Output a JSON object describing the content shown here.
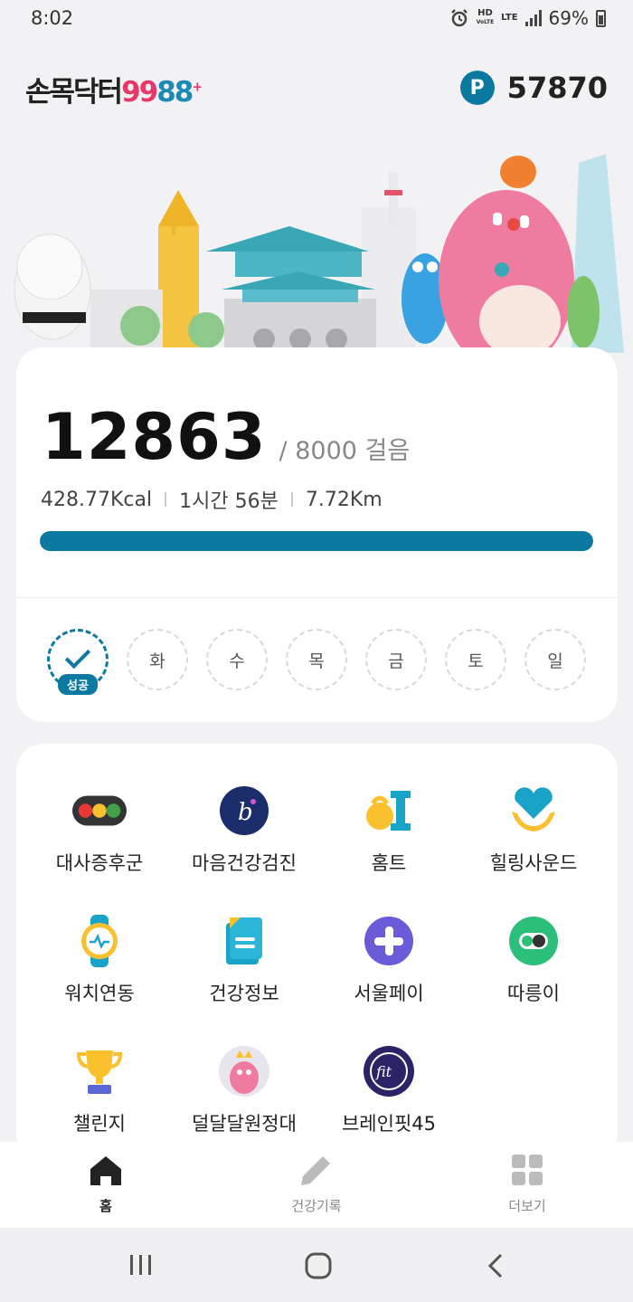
{
  "status": {
    "time": "8:02",
    "network_top": "HD",
    "network_sub": "VoLTE",
    "lte": "LTE",
    "battery": "69%"
  },
  "header": {
    "logo_text": "손목닥터",
    "logo_num_a": "99",
    "logo_num_b": "88",
    "logo_plus": "+",
    "point_badge": "P",
    "points": "57870"
  },
  "steps": {
    "count": "12863",
    "goal": "/ 8000 걸음",
    "kcal": "428.77Kcal",
    "time": "1시간 56분",
    "distance": "7.72Km",
    "progress": 1.0
  },
  "week": [
    {
      "label": "",
      "done": true,
      "badge": "성공"
    },
    {
      "label": "화",
      "done": false
    },
    {
      "label": "수",
      "done": false
    },
    {
      "label": "목",
      "done": false
    },
    {
      "label": "금",
      "done": false
    },
    {
      "label": "토",
      "done": false
    },
    {
      "label": "일",
      "done": false
    }
  ],
  "menu": [
    {
      "label": "대사증후군",
      "icon": "traffic-light-icon"
    },
    {
      "label": "마음건강검진",
      "icon": "mind-check-icon"
    },
    {
      "label": "홈트",
      "icon": "kettlebell-icon"
    },
    {
      "label": "힐링사운드",
      "icon": "heart-hands-icon"
    },
    {
      "label": "워치연동",
      "icon": "smartwatch-icon"
    },
    {
      "label": "건강정보",
      "icon": "document-icon"
    },
    {
      "label": "서울페이",
      "icon": "plus-circle-icon"
    },
    {
      "label": "따릉이",
      "icon": "bike-toggle-icon"
    },
    {
      "label": "챌린지",
      "icon": "trophy-icon"
    },
    {
      "label": "덜달달원정대",
      "icon": "character-icon"
    },
    {
      "label": "브레인핏45",
      "icon": "brainfit-icon"
    }
  ],
  "bottom_nav": [
    {
      "label": "홈",
      "icon": "home-icon",
      "active": true
    },
    {
      "label": "건강기록",
      "icon": "pencil-icon",
      "active": false
    },
    {
      "label": "더보기",
      "icon": "grid-icon",
      "active": false
    }
  ],
  "colors": {
    "accent": "#0c79a0",
    "brand_pink": "#e8386a"
  }
}
